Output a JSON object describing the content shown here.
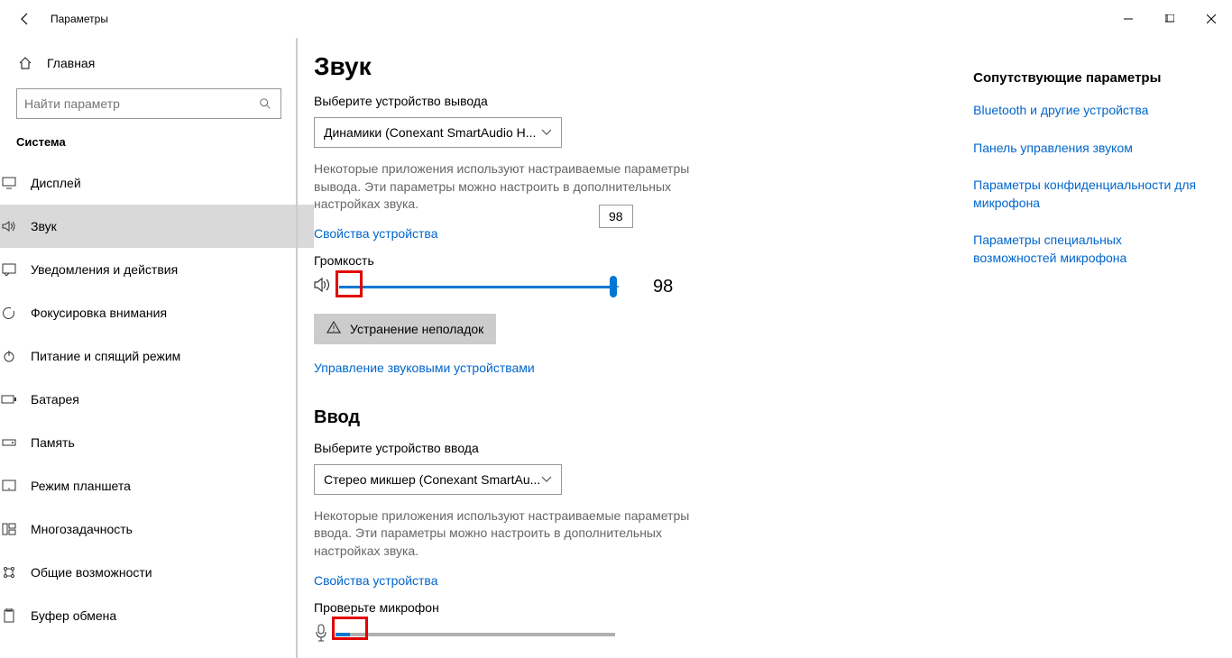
{
  "titlebar": {
    "title": "Параметры"
  },
  "sidebar": {
    "home_label": "Главная",
    "search_placeholder": "Найти параметр",
    "category": "Система",
    "items": [
      {
        "label": "Дисплей"
      },
      {
        "label": "Звук"
      },
      {
        "label": "Уведомления и действия"
      },
      {
        "label": "Фокусировка внимания"
      },
      {
        "label": "Питание и спящий режим"
      },
      {
        "label": "Батарея"
      },
      {
        "label": "Память"
      },
      {
        "label": "Режим планшета"
      },
      {
        "label": "Многозадачность"
      },
      {
        "label": "Общие возможности"
      },
      {
        "label": "Буфер обмена"
      }
    ]
  },
  "main": {
    "title": "Звук",
    "output_section": {
      "label": "Выберите устройство вывода",
      "device": "Динамики (Conexant SmartAudio H...",
      "help": "Некоторые приложения используют настраиваемые параметры вывода. Эти параметры можно настроить в дополнительных настройках звука.",
      "props_link": "Свойства устройства",
      "volume_label": "Громкость",
      "volume_value": "98",
      "tooltip": "98",
      "troubleshoot": "Устранение неполадок",
      "manage_link": "Управление звуковыми устройствами"
    },
    "input_section": {
      "title": "Ввод",
      "label": "Выберите устройство ввода",
      "device": "Стерео микшер (Conexant SmartAu...",
      "help": "Некоторые приложения используют настраиваемые параметры ввода. Эти параметры можно настроить в дополнительных настройках звука.",
      "props_link": "Свойства устройства",
      "test_label": "Проверьте микрофон"
    }
  },
  "aside": {
    "title": "Сопутствующие параметры",
    "links": [
      "Bluetooth и другие устройства",
      "Панель управления звуком",
      "Параметры конфиденциальности для микрофона",
      "Параметры специальных возможностей микрофона"
    ]
  }
}
